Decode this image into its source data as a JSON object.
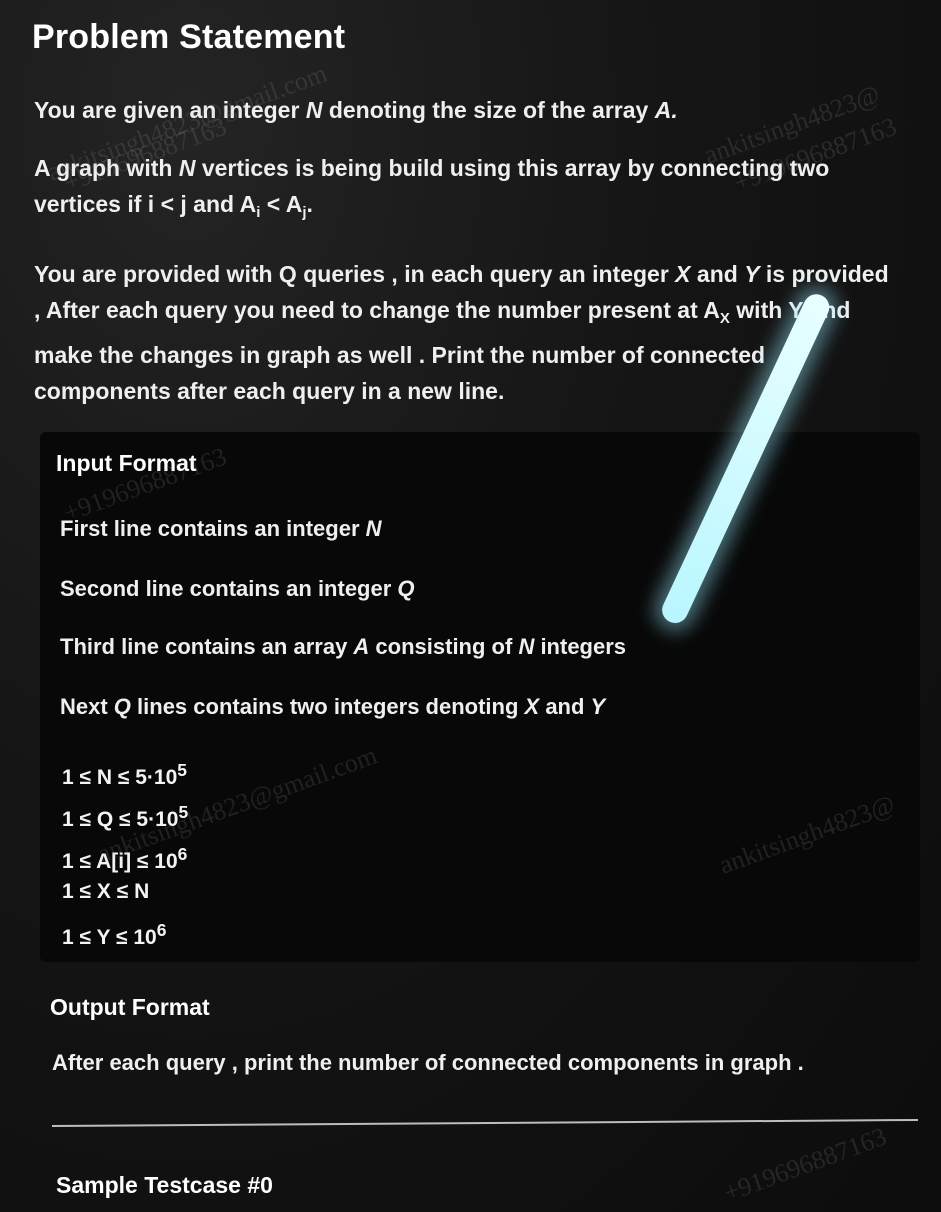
{
  "problem": {
    "title": "Problem Statement",
    "intro_pre": "You are given an integer ",
    "intro_var": "N",
    "intro_mid": " denoting the size of the array ",
    "intro_arr": "A.",
    "graph_pre": "A graph with ",
    "graph_var": "N",
    "graph_mid": " vertices is being build using this array by connecting two vertices if i < j and A",
    "graph_sub_i": "i",
    "graph_lt": " < A",
    "graph_sub_j": "j",
    "graph_end": ".",
    "query_pre": "You are provided with Q queries , in each query an integer ",
    "query_x": "X",
    "query_and": " and ",
    "query_y": "Y",
    "query_mid": " is provided , After each query you need to change the number present at A",
    "query_sub_x": "X",
    "query_end": " with Y and make the changes in graph as well . Print the number of connected components after each query in a new line."
  },
  "input_format": {
    "heading": "Input Format",
    "line1_pre": "First line contains an integer ",
    "line1_var": "N",
    "line2_pre": "Second line contains an integer ",
    "line2_var": "Q",
    "line3_pre": "Third line contains an array ",
    "line3_var_a": "A",
    "line3_mid": " consisting of ",
    "line3_var_n": "N",
    "line3_end": " integers",
    "line4_var_q": "Q",
    "line4_mid": " lines contains two integers denoting ",
    "line4_var_x": "X",
    "line4_and": " and ",
    "line4_var_y": "Y",
    "line4_pre": "Next "
  },
  "constraints": {
    "c1": "1 ≤ N ≤ 5·10",
    "c1_exp": "5",
    "c2": "1 ≤ Q ≤ 5·10",
    "c2_exp": "5",
    "c3": "1 ≤  A[i] ≤ 10",
    "c3_exp": "6",
    "c4": "1 ≤ X ≤ N",
    "c5": "1 ≤ Y ≤ 10",
    "c5_exp": "6"
  },
  "output_format": {
    "heading": "Output Format",
    "text": "After each query , print the number of connected components in graph ."
  },
  "sample": {
    "heading": "Sample Testcase #0"
  },
  "watermarks": {
    "w1": "ankitsingh4823@gmail.com",
    "w2": "+919696887163",
    "w3": "ankitsingh4823@",
    "w4": "+919696887163",
    "w5": "ankitsingh4823@gmail.com",
    "w6": "+919696887163",
    "w7": "ankitsingh4823@",
    "w8": "+919696887163"
  }
}
